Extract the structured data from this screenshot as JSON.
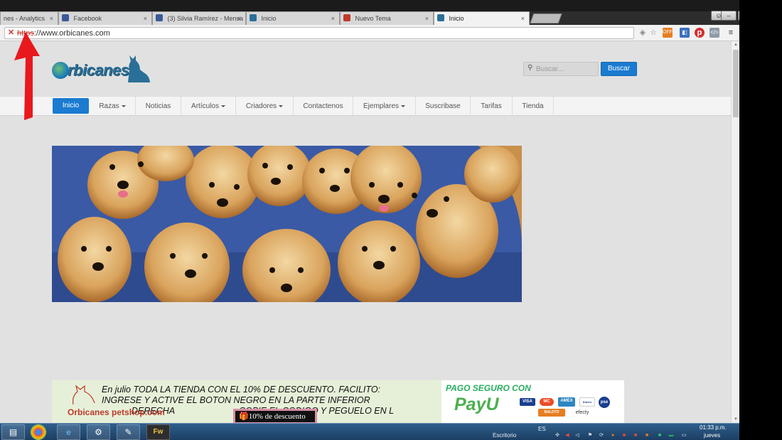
{
  "browser": {
    "tabs": [
      {
        "title": "nes - Analytics",
        "favicon_color": "#f39c12"
      },
      {
        "title": "Facebook",
        "favicon_color": "#3b5998"
      },
      {
        "title": "(3) Silvia Ramírez - Mensa",
        "favicon_color": "#3b5998"
      },
      {
        "title": "Inicio",
        "favicon_color": "#2a6f97"
      },
      {
        "title": "Nuevo Tema",
        "favicon_color": "#c0392b"
      },
      {
        "title": "Inicio",
        "favicon_color": "#2a6f97"
      }
    ],
    "active_tab_index": 5,
    "tab_close_glyph": "×",
    "url_scheme": "https",
    "url_rest": "://www.orbicanes.com",
    "window_buttons": {
      "minimize": "–",
      "maximize": "□",
      "close": "✕"
    }
  },
  "site": {
    "logo_text": "rbicanes",
    "search": {
      "placeholder": "Buscar...",
      "button_label": "Buscar"
    },
    "nav": [
      {
        "label": "Inicio",
        "dropdown": false
      },
      {
        "label": "Razas",
        "dropdown": true
      },
      {
        "label": "Noticias",
        "dropdown": false
      },
      {
        "label": "Artículos",
        "dropdown": true
      },
      {
        "label": "Criadores",
        "dropdown": true
      },
      {
        "label": "Contactenos",
        "dropdown": false
      },
      {
        "label": "Ejemplares",
        "dropdown": true
      },
      {
        "label": "Suscribase",
        "dropdown": false
      },
      {
        "label": "Tarifas",
        "dropdown": false
      },
      {
        "label": "Tienda",
        "dropdown": false
      }
    ],
    "promo": {
      "line1": "En julio TODA LA TIENDA CON EL 10% DE DESCUENTO. FACILITO:",
      "line2": "INGRESE Y ACTIVE EL BOTON NEGRO  EN LA PARTE INFERIOR",
      "line3": "DERECHA                          COPIE EL CODIGO Y PEGUELO EN L",
      "brand": "Orbicanes petshop.com"
    },
    "payment": {
      "title": "PAGO SEGURO CON",
      "logo": "PayU",
      "methods": [
        "VISA",
        "MC",
        "AMEX",
        "Diners Club",
        "pse",
        "BALOTO",
        "efecty"
      ]
    },
    "discount_popup": "10% de descuento"
  },
  "taskbar": {
    "apps": [
      "file-explorer",
      "chrome",
      "internet-explorer",
      "control-panel",
      "notepad",
      "fireworks"
    ],
    "desktop_label": "Escritorio",
    "language": "ES",
    "time": "01:33 p.m.",
    "day": "jueves"
  },
  "colors": {
    "accent": "#1a7bd0",
    "page_bg": "#e1e1e1",
    "arrow": "#e8181d"
  }
}
